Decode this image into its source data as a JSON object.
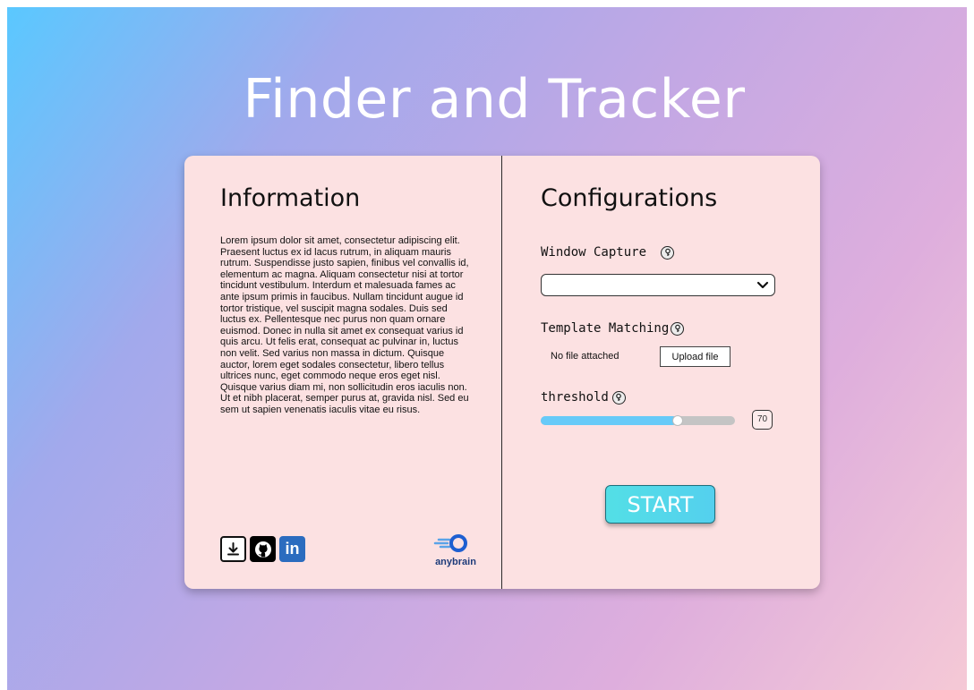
{
  "app": {
    "title": "Finder and Tracker"
  },
  "info": {
    "heading": "Information",
    "body": "Lorem ipsum dolor sit amet, consectetur adipiscing elit. Praesent luctus ex id lacus rutrum, in aliquam mauris rutrum. Suspendisse justo sapien, finibus vel convallis id, elementum ac magna. Aliquam consectetur nisi at tortor tincidunt vestibulum. Interdum et malesuada fames ac ante ipsum primis in faucibus. Nullam tincidunt augue id tortor tristique, vel suscipit magna sodales. Duis sed luctus ex. Pellentesque nec purus non quam ornare euismod. Donec in nulla sit amet ex consequat varius id quis arcu. Ut felis erat, consequat ac pulvinar in, luctus non velit. Sed varius non massa in dictum. Quisque auctor, lorem eget sodales consectetur, libero tellus ultrices nunc, eget commodo neque eros eget nisl. Quisque varius diam mi, non sollicitudin eros iaculis non. Ut et nibh placerat, semper purus at, gravida nisl. Sed eu sem ut sapien venenatis iaculis vitae eu risus.",
    "links": [
      {
        "icon": "download-icon"
      },
      {
        "icon": "github-icon"
      },
      {
        "icon": "linkedin-icon",
        "glyph": "in"
      }
    ],
    "brand": {
      "icon": "anybrain-logo-icon",
      "text": "anybrain"
    }
  },
  "config": {
    "heading": "Configurations",
    "window_capture": {
      "label": "Window Capture",
      "selected": ""
    },
    "template_matching": {
      "label": "Template Matching",
      "file_status": "No file attached",
      "upload_label": "Upload file"
    },
    "threshold": {
      "label": "threshold",
      "value": "70",
      "fraction": 0.7
    },
    "start_label": "START"
  },
  "colors": {
    "card_background": "#fce1e2",
    "start_button": "#53dfe6",
    "slider_fill": "#67caf8",
    "slider_track": "#c4c4c4"
  }
}
